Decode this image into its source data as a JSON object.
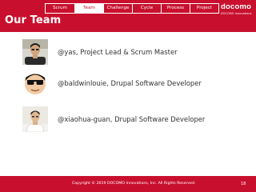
{
  "header": {
    "title": "Our Team",
    "tabs": [
      {
        "label": "Scrum",
        "active": false
      },
      {
        "label": "Team",
        "active": true
      },
      {
        "label": "Challenge",
        "active": false
      },
      {
        "label": "Cycle",
        "active": false
      },
      {
        "label": "Process",
        "active": false
      },
      {
        "label": "Project",
        "active": false
      }
    ],
    "logo": {
      "wordmark": "docomo",
      "tagline": "DOCOMO Innovations"
    },
    "accent_color": "#c8102e"
  },
  "members": [
    {
      "text": "@yas, Project Lead & Scrum Master",
      "avatar": "person-photo-avatar"
    },
    {
      "text": "@baldwinlouie, Drupal Software Developer",
      "avatar": "sunglasses-face-avatar"
    },
    {
      "text": "@xiaohua-guan, Drupal Software Developer",
      "avatar": "person-photo-avatar"
    }
  ],
  "footer": {
    "copyright": "Copyright © 2019 DOCOMO Innovations, Inc.  All Rights Reserved.",
    "page_number": "18"
  }
}
